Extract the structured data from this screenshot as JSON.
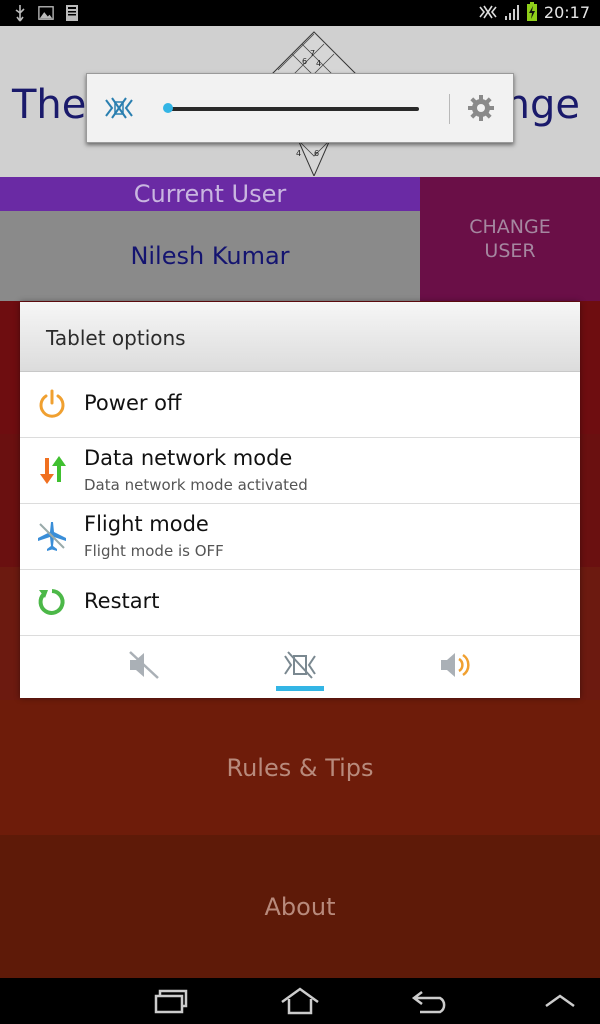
{
  "status_bar": {
    "time": "20:17",
    "left_icons": [
      "usb-icon",
      "image-icon",
      "sd-card-icon"
    ],
    "right_icons": [
      "vibrate-icon",
      "signal-icon",
      "battery-charging-icon"
    ]
  },
  "app": {
    "title_left": "The",
    "title_right": "enge",
    "current_user_label": "Current User",
    "user_name": "Nilesh Kumar",
    "change_user_label": "CHANGE\nUSER",
    "menu": [
      "",
      "",
      "",
      "Rules & Tips",
      "About"
    ]
  },
  "volume_popup": {
    "icon": "vibrate-icon",
    "level": 0,
    "settings_icon": "gear-icon"
  },
  "dialog": {
    "title": "Tablet options",
    "options": [
      {
        "label": "Power off",
        "sublabel": "",
        "icon": "power-icon"
      },
      {
        "label": "Data network mode",
        "sublabel": "Data network mode activated",
        "icon": "data-arrows-icon"
      },
      {
        "label": "Flight mode",
        "sublabel": "Flight mode is OFF",
        "icon": "airplane-icon"
      },
      {
        "label": "Restart",
        "sublabel": "",
        "icon": "restart-icon"
      }
    ],
    "sound_modes": [
      {
        "name": "mute",
        "icon": "mute-icon",
        "selected": false
      },
      {
        "name": "vibrate",
        "icon": "vibrate-icon",
        "selected": true
      },
      {
        "name": "sound",
        "icon": "speaker-icon",
        "selected": false
      }
    ]
  },
  "colors": {
    "accent": "#33b5e5",
    "current_user_bar": "#6a2aa4",
    "change_user_bg": "#6a0f47"
  },
  "navbar": [
    "recent-apps-icon",
    "home-icon",
    "back-icon",
    "menu-up-icon"
  ]
}
